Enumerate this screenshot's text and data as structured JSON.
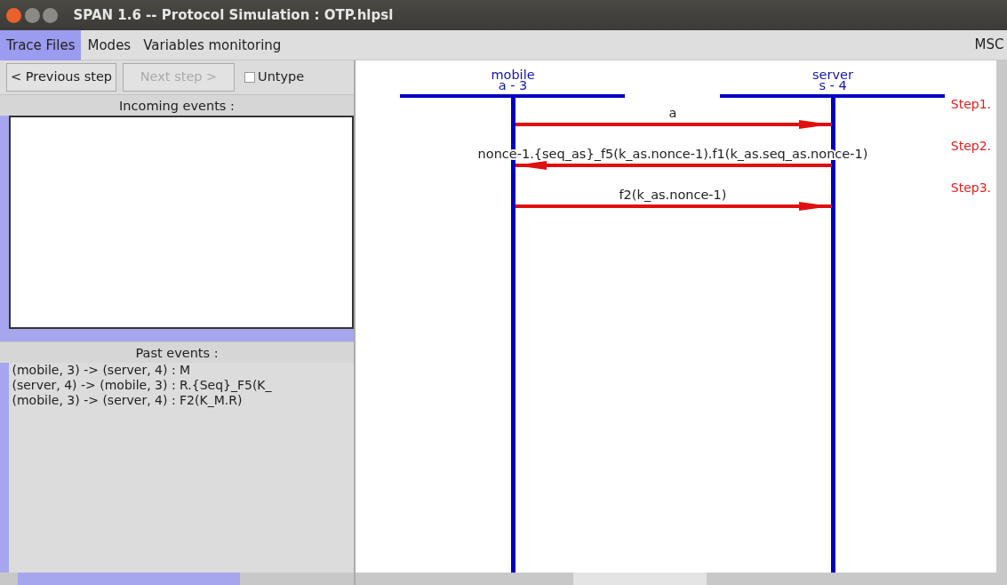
{
  "window": {
    "title": "SPAN 1.6 -- Protocol Simulation : OTP.hlpsl"
  },
  "menu": [
    {
      "label": "Trace Files",
      "selected": true
    },
    {
      "label": "Modes",
      "selected": false
    },
    {
      "label": "Variables monitoring",
      "selected": false
    }
  ],
  "menu_right": "MSC",
  "toolbar": {
    "buttons": [
      {
        "label": "< Previous step",
        "disabled": false
      },
      {
        "label": "Next step >",
        "disabled": true
      }
    ],
    "checkbox": {
      "label": "Untype",
      "checked": false
    }
  },
  "incoming_events": {
    "title": "Incoming events :"
  },
  "past_events": {
    "title": "Past events :",
    "items": [
      "(mobile, 3) -> (server, 4) : M",
      "(server, 4) -> (mobile, 3) : R.{Seq}_F5(K_",
      "(mobile, 3) -> (server, 4) : F2(K_M.R)"
    ]
  },
  "msc": {
    "participants": [
      {
        "name": "mobile",
        "instance": "a - 3"
      },
      {
        "name": "server",
        "instance": "s - 4"
      }
    ],
    "messages": [
      {
        "leftward": false,
        "label": "a",
        "step": "Step1."
      },
      {
        "leftward": true,
        "label": "nonce-1.{seq_as}_f5(k_as.nonce-1).f1(k_as.seq_as.nonce-1)",
        "step": "Step2."
      },
      {
        "leftward": false,
        "label": "f2(k_as.nonce-1)",
        "step": "Step3."
      }
    ]
  }
}
